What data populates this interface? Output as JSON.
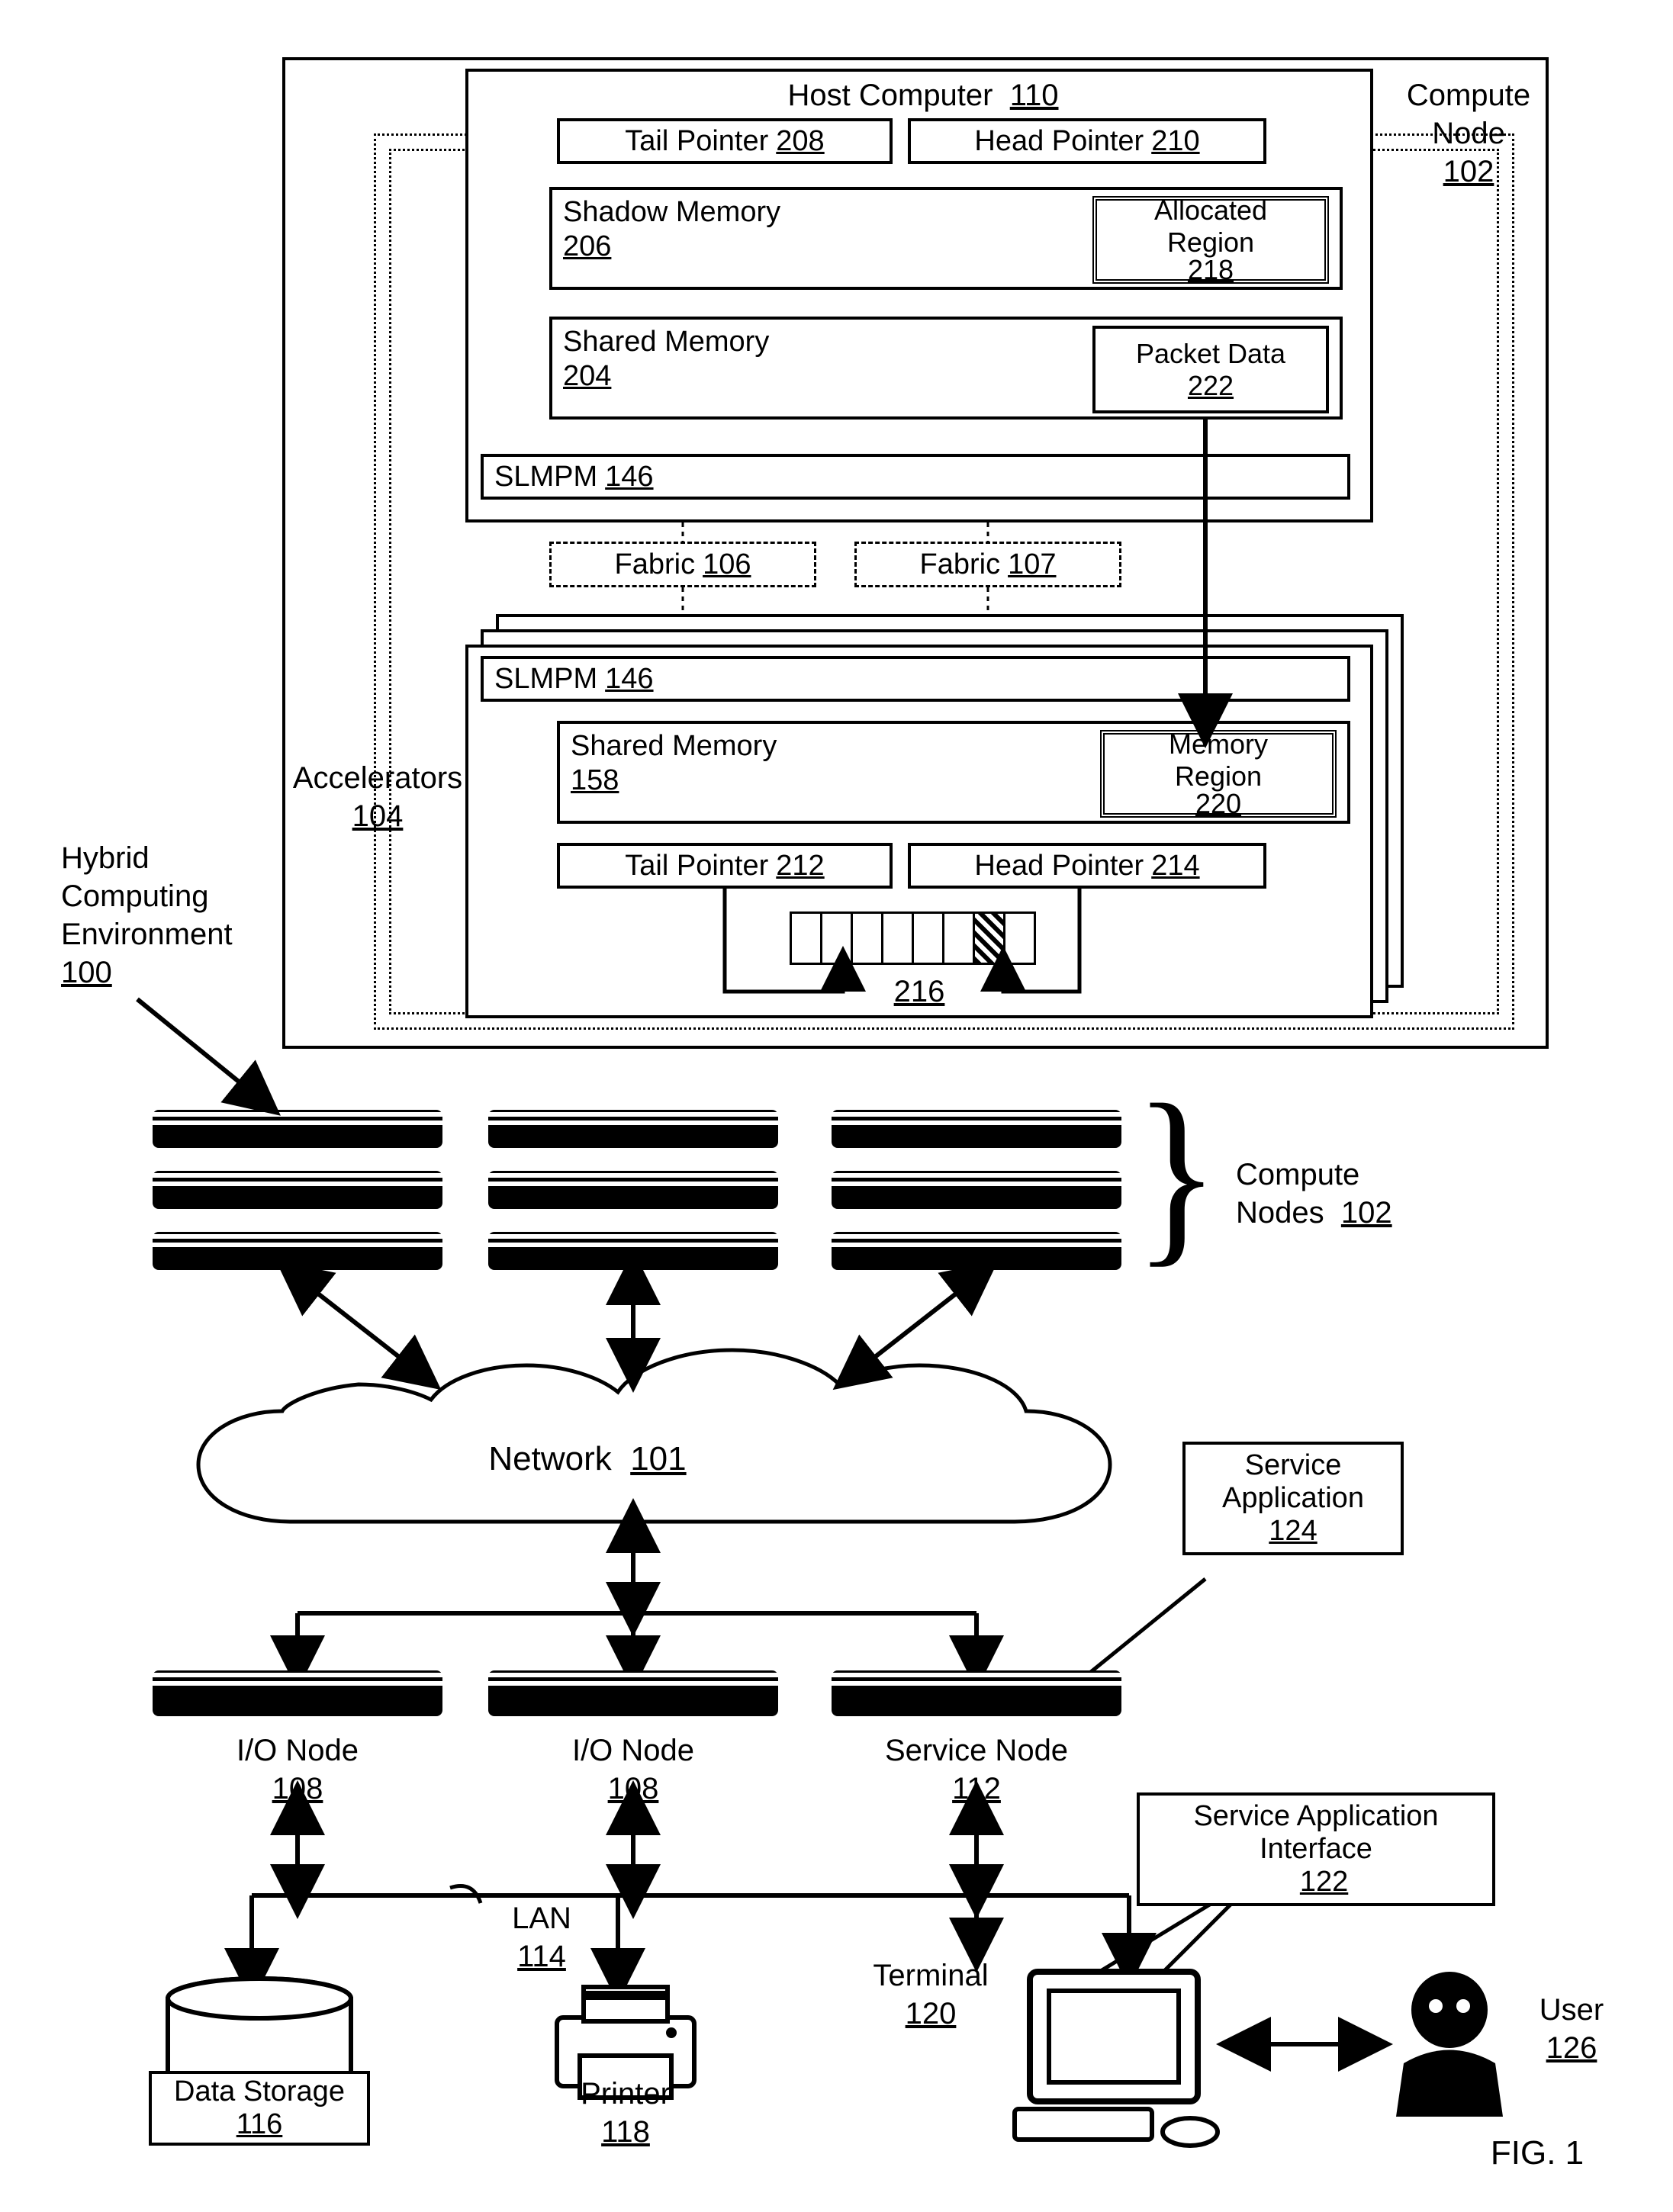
{
  "title_label": "Hybrid\nComputing\nEnvironment",
  "title_ref": "100",
  "compute_node_label": "Compute\nNode",
  "compute_node_ref": "102",
  "host_computer": {
    "label": "Host Computer",
    "ref": "110"
  },
  "tail_pointer_host": {
    "label": "Tail Pointer",
    "ref": "208"
  },
  "head_pointer_host": {
    "label": "Head Pointer",
    "ref": "210"
  },
  "shadow_memory": {
    "label": "Shadow Memory",
    "ref": "206"
  },
  "allocated_region": {
    "label": "Allocated\nRegion",
    "ref": "218"
  },
  "shared_memory_host": {
    "label": "Shared Memory",
    "ref": "204"
  },
  "packet_data": {
    "label": "Packet Data",
    "ref": "222"
  },
  "slmpm": {
    "label": "SLMPM",
    "ref": "146"
  },
  "fabric_a": {
    "label": "Fabric",
    "ref": "106"
  },
  "fabric_b": {
    "label": "Fabric",
    "ref": "107"
  },
  "accelerators": {
    "label": "Accelerators",
    "ref": "104"
  },
  "shared_memory_acc": {
    "label": "Shared Memory",
    "ref": "158"
  },
  "memory_region": {
    "label": "Memory\nRegion",
    "ref": "220"
  },
  "tail_pointer_acc": {
    "label": "Tail Pointer",
    "ref": "212"
  },
  "head_pointer_acc": {
    "label": "Head Pointer",
    "ref": "214"
  },
  "fifo_ref": "216",
  "compute_nodes_group": {
    "label": "Compute\nNodes",
    "ref": "102"
  },
  "network": {
    "label": "Network",
    "ref": "101"
  },
  "service_app": {
    "label": "Service\nApplication",
    "ref": "124"
  },
  "io_node": {
    "label": "I/O Node",
    "ref": "108"
  },
  "service_node": {
    "label": "Service Node",
    "ref": "112"
  },
  "sai": {
    "label": "Service Application\nInterface",
    "ref": "122"
  },
  "lan": {
    "label": "LAN",
    "ref": "114"
  },
  "data_storage": {
    "label": "Data Storage",
    "ref": "116"
  },
  "printer": {
    "label": "Printer",
    "ref": "118"
  },
  "terminal": {
    "label": "Terminal",
    "ref": "120"
  },
  "user": {
    "label": "User",
    "ref": "126"
  },
  "fig_label": "FIG. 1"
}
